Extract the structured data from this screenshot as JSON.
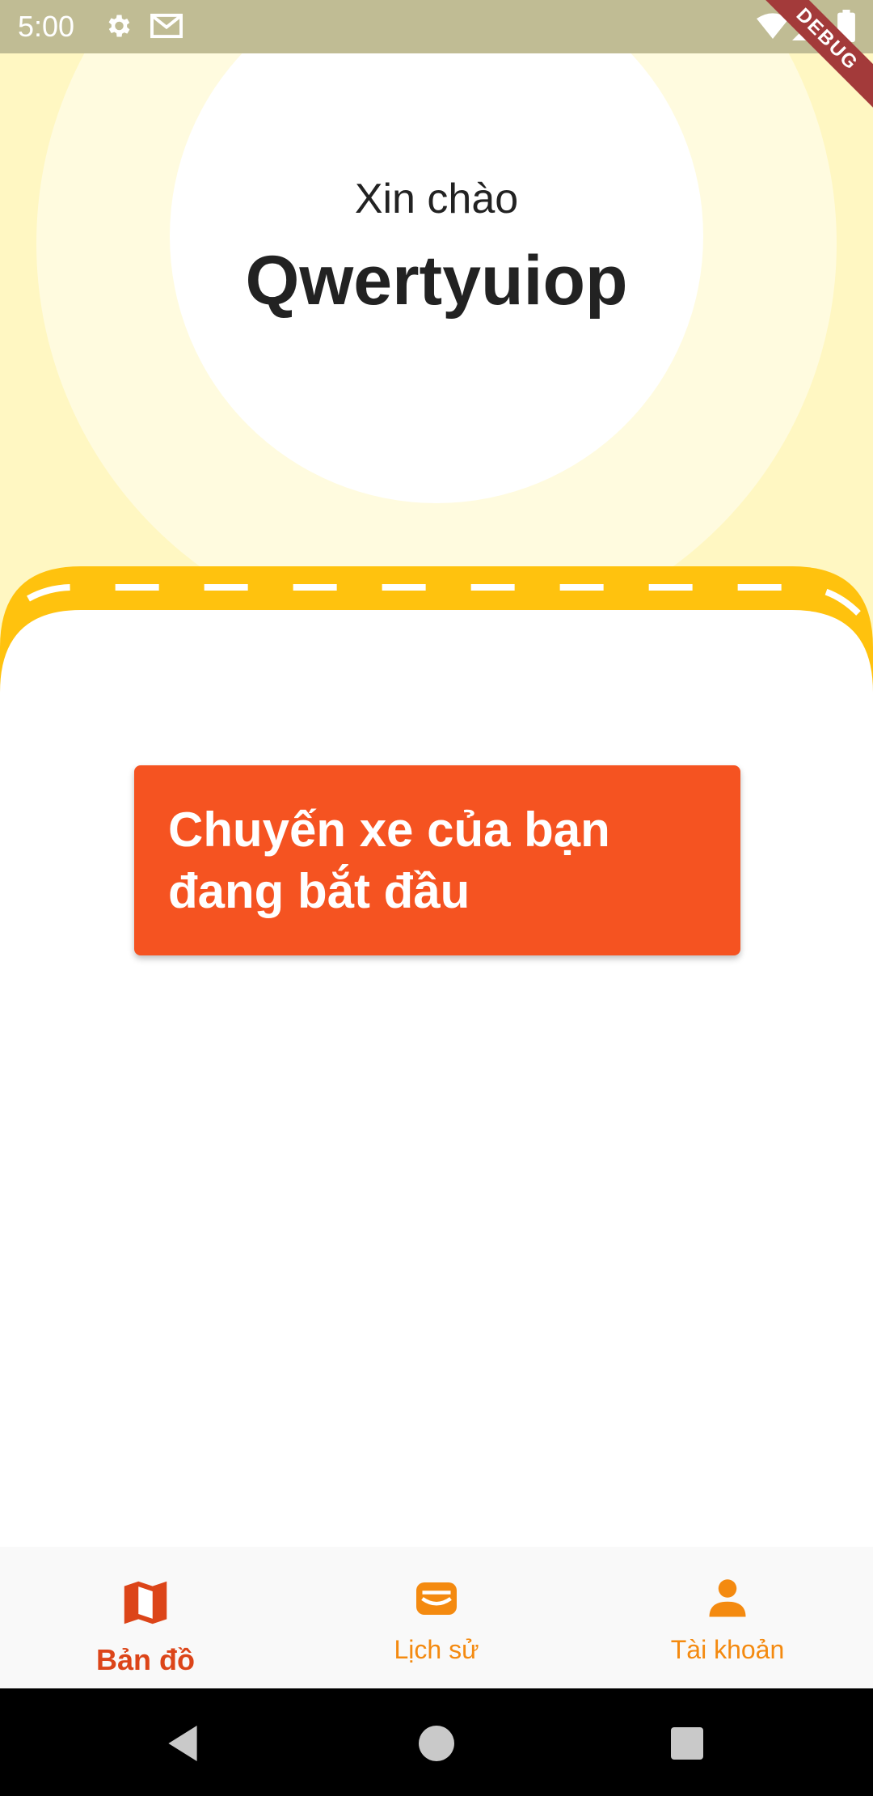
{
  "status_bar": {
    "time": "5:00",
    "icons": [
      "settings-icon",
      "gmail-icon",
      "wifi-icon",
      "signal-icon",
      "battery-icon"
    ]
  },
  "debug_banner": "DEBUG",
  "header": {
    "greeting": "Xin chào",
    "username": "Qwertyuiop"
  },
  "trip_card": {
    "text": "Chuyến xe của bạn đang bắt đầu"
  },
  "bottom_nav": {
    "items": [
      {
        "label": "Bản đồ",
        "icon": "map-icon",
        "active": true
      },
      {
        "label": "Lịch sử",
        "icon": "wallet-icon",
        "active": false
      },
      {
        "label": "Tài khoản",
        "icon": "person-icon",
        "active": false
      }
    ]
  },
  "colors": {
    "status_bar": "#c0bc94",
    "header_bg": "#fff7c2",
    "road": "#ffc20e",
    "card": "#f55321",
    "nav_active": "#dc4519",
    "nav_inactive": "#f48a10"
  }
}
